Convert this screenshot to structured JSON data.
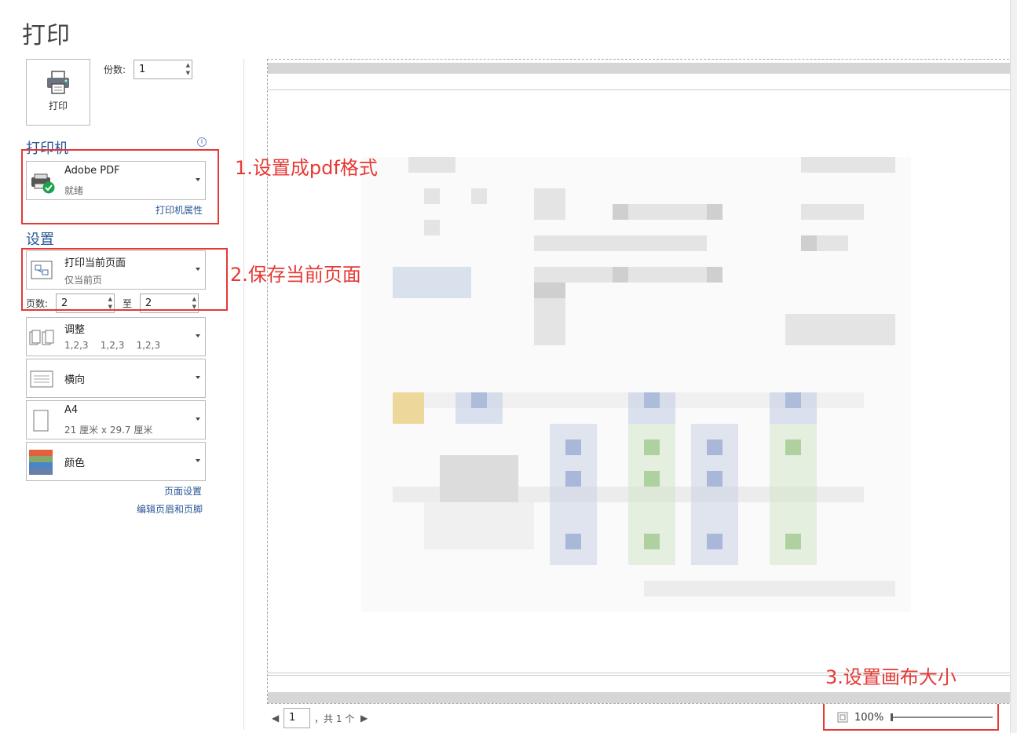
{
  "page_title": "打印",
  "print_button": {
    "label": "打印",
    "icon": "printer-icon"
  },
  "copies": {
    "label": "份数:",
    "value": "1"
  },
  "printer": {
    "heading": "打印机",
    "name": "Adobe PDF",
    "status": "就绪",
    "properties_link": "打印机属性",
    "icon": "printer-ready-icon"
  },
  "settings": {
    "heading": "设置",
    "range": {
      "main": "打印当前页面",
      "sub": "仅当前页"
    },
    "pages": {
      "label": "页数:",
      "from": "2",
      "to_label": "至",
      "to": "2"
    },
    "collate": {
      "main": "调整",
      "sub": "1,2,3    1,2,3    1,2,3"
    },
    "orientation": {
      "main": "横向"
    },
    "paper": {
      "main": "A4",
      "sub": "21 厘米 x 29.7 厘米"
    },
    "color": {
      "main": "颜色"
    },
    "page_setup_link": "页面设置",
    "header_footer_link": "编辑页眉和页脚"
  },
  "annotations": {
    "a1": "1.设置成pdf格式",
    "a2": "2.保存当前页面",
    "a3": "3.设置画布大小"
  },
  "preview_nav": {
    "page": "1",
    "total": "，共 1 个"
  },
  "zoom": {
    "value": "100%"
  },
  "colors": {
    "accent": "#2b5797",
    "annotation": "#e53935"
  }
}
